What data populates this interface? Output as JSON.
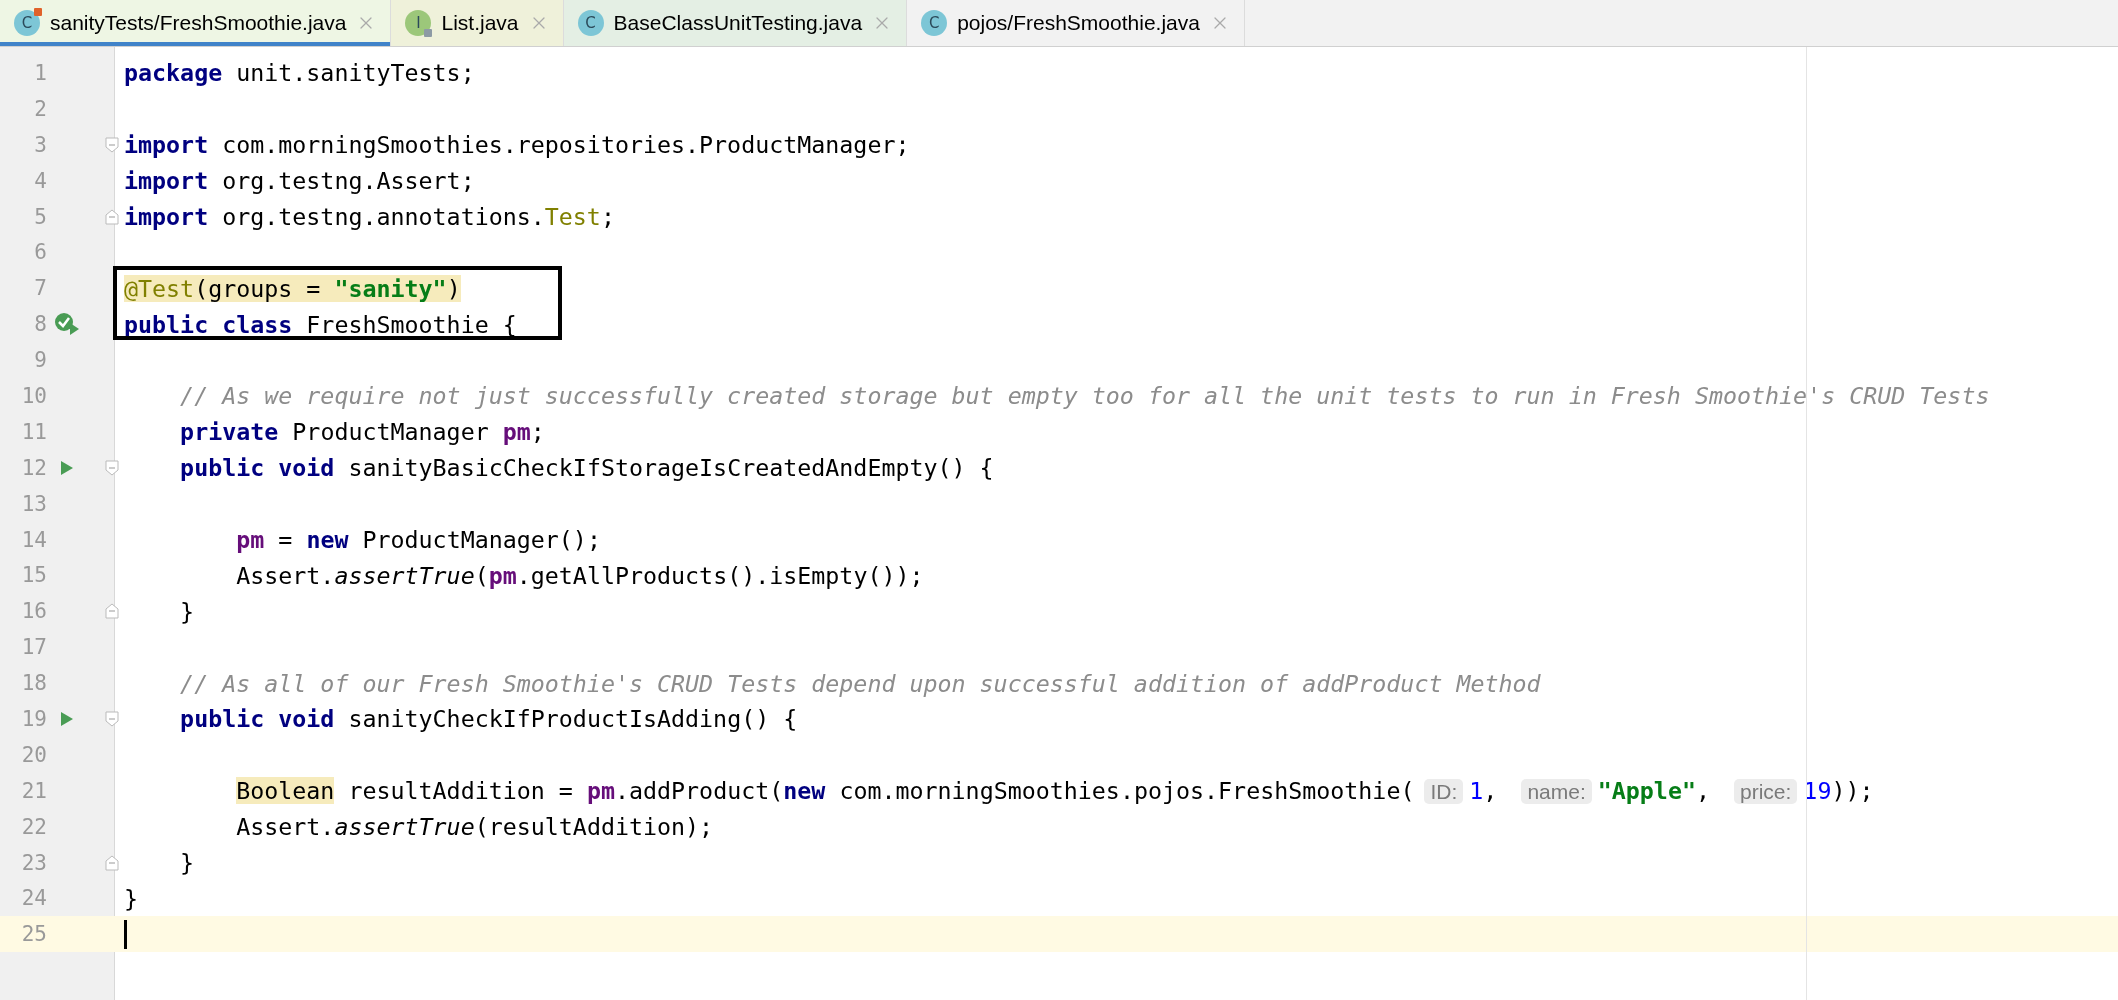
{
  "tabs": [
    {
      "label": "sanityTests/FreshSmoothie.java",
      "icon": {
        "kind": "test-class",
        "letter": "C"
      },
      "color": "#eef6e4",
      "selected": true
    },
    {
      "label": "List.java",
      "icon": {
        "kind": "interface",
        "letter": "I"
      },
      "color": "#eff1da",
      "selected": false
    },
    {
      "label": "BaseClassUnitTesting.java",
      "icon": {
        "kind": "class",
        "letter": "C"
      },
      "color": "#e4efe4",
      "selected": false
    },
    {
      "label": "pojos/FreshSmoothie.java",
      "icon": {
        "kind": "class",
        "letter": "C"
      },
      "color": "#f2f2f2",
      "selected": false
    }
  ],
  "editor": {
    "lines": [
      {
        "number": "1",
        "current": false,
        "tokens": [
          {
            "kind": "keyword",
            "text": "package"
          },
          {
            "kind": "plain",
            "text": " unit.sanityTests;"
          }
        ]
      },
      {
        "number": "2",
        "current": false
      },
      {
        "number": "3",
        "current": false,
        "fold": {
          "kind": "start"
        },
        "tokens": [
          {
            "kind": "keyword",
            "text": "import"
          },
          {
            "kind": "plain",
            "text": " com.morningSmoothies.repositories.ProductManager;"
          }
        ]
      },
      {
        "number": "4",
        "current": false,
        "tokens": [
          {
            "kind": "keyword",
            "text": "import"
          },
          {
            "kind": "plain",
            "text": " org.testng.Assert;"
          }
        ]
      },
      {
        "number": "5",
        "current": false,
        "fold": {
          "kind": "end"
        },
        "tokens": [
          {
            "kind": "keyword",
            "text": "import"
          },
          {
            "kind": "plain",
            "text": " org.testng.annotations."
          },
          {
            "kind": "annotation",
            "text": "Test"
          },
          {
            "kind": "plain",
            "text": ";"
          }
        ]
      },
      {
        "number": "6",
        "current": false
      },
      {
        "number": "7",
        "current": false,
        "boxed": true,
        "tokens": [
          {
            "kind": "usage",
            "children": [
              {
                "kind": "annotation",
                "text": "@Test"
              },
              {
                "kind": "plain",
                "text": "(groups = "
              },
              {
                "kind": "string",
                "text": "\"sanity\""
              },
              {
                "kind": "plain",
                "text": ")"
              }
            ]
          }
        ]
      },
      {
        "number": "8",
        "current": false,
        "boxed": true,
        "marker": {
          "kind": "run-passed"
        },
        "tokens": [
          {
            "kind": "keyword",
            "text": "public class"
          },
          {
            "kind": "plain",
            "text": " FreshSmoothie {"
          }
        ]
      },
      {
        "number": "9",
        "current": false
      },
      {
        "number": "10",
        "current": false,
        "tokens": [
          {
            "kind": "comment",
            "text": "    // As we require not just successfully created storage but empty too for all the unit tests to run in Fresh Smoothie's CRUD Tests"
          }
        ]
      },
      {
        "number": "11",
        "current": false,
        "tokens": [
          {
            "kind": "keyword",
            "text": "    private"
          },
          {
            "kind": "plain",
            "text": " ProductManager "
          },
          {
            "kind": "field",
            "text": "pm"
          },
          {
            "kind": "plain",
            "text": ";"
          }
        ]
      },
      {
        "number": "12",
        "current": false,
        "marker": {
          "kind": "run"
        },
        "fold": {
          "kind": "start"
        },
        "tokens": [
          {
            "kind": "keyword",
            "text": "    public void"
          },
          {
            "kind": "plain",
            "text": " sanityBasicCheckIfStorageIsCreatedAndEmpty() {"
          }
        ]
      },
      {
        "number": "13",
        "current": false
      },
      {
        "number": "14",
        "current": false,
        "tokens": [
          {
            "kind": "field",
            "text": "        pm"
          },
          {
            "kind": "plain",
            "text": " = "
          },
          {
            "kind": "keyword",
            "text": "new"
          },
          {
            "kind": "plain",
            "text": " ProductManager();"
          }
        ]
      },
      {
        "number": "15",
        "current": false,
        "tokens": [
          {
            "kind": "plain",
            "text": "        Assert."
          },
          {
            "kind": "static",
            "text": "assertTrue"
          },
          {
            "kind": "plain",
            "text": "("
          },
          {
            "kind": "field",
            "text": "pm"
          },
          {
            "kind": "plain",
            "text": ".getAllProducts().isEmpty());"
          }
        ]
      },
      {
        "number": "16",
        "current": false,
        "fold": {
          "kind": "end"
        },
        "tokens": [
          {
            "kind": "plain",
            "text": "    }"
          }
        ]
      },
      {
        "number": "17",
        "current": false
      },
      {
        "number": "18",
        "current": false,
        "tokens": [
          {
            "kind": "comment",
            "text": "    // As all of our Fresh Smoothie's CRUD Tests depend upon successful addition of addProduct Method"
          }
        ]
      },
      {
        "number": "19",
        "current": false,
        "marker": {
          "kind": "run"
        },
        "fold": {
          "kind": "start"
        },
        "tokens": [
          {
            "kind": "keyword",
            "text": "    public void"
          },
          {
            "kind": "plain",
            "text": " sanityCheckIfProductIsAdding() {"
          }
        ]
      },
      {
        "number": "20",
        "current": false
      },
      {
        "number": "21",
        "current": false,
        "tokens": [
          {
            "kind": "usage",
            "children": [
              {
                "kind": "plain",
                "text": "        Boolean"
              }
            ]
          },
          {
            "kind": "plain",
            "text": " resultAddition = "
          },
          {
            "kind": "field",
            "text": "pm"
          },
          {
            "kind": "plain",
            "text": ".addProduct("
          },
          {
            "kind": "keyword",
            "text": "new"
          },
          {
            "kind": "plain",
            "text": " com.morningSmoothies.pojos.FreshSmoothie("
          },
          {
            "kind": "hint",
            "text": "ID:"
          },
          {
            "kind": "number",
            "text": "1"
          },
          {
            "kind": "plain",
            "text": ", "
          },
          {
            "kind": "hint",
            "text": "name:"
          },
          {
            "kind": "string",
            "text": "\"Apple\""
          },
          {
            "kind": "plain",
            "text": ", "
          },
          {
            "kind": "hint",
            "text": "price:"
          },
          {
            "kind": "number",
            "text": "19"
          },
          {
            "kind": "plain",
            "text": "));"
          }
        ]
      },
      {
        "number": "22",
        "current": false,
        "tokens": [
          {
            "kind": "plain",
            "text": "        Assert."
          },
          {
            "kind": "static",
            "text": "assertTrue"
          },
          {
            "kind": "plain",
            "text": "(resultAddition);"
          }
        ]
      },
      {
        "number": "23",
        "current": false,
        "fold": {
          "kind": "end"
        },
        "tokens": [
          {
            "kind": "plain",
            "text": "    }"
          }
        ]
      },
      {
        "number": "24",
        "current": false,
        "tokens": [
          {
            "kind": "plain",
            "text": "}"
          }
        ]
      },
      {
        "number": "25",
        "current": true
      }
    ]
  }
}
